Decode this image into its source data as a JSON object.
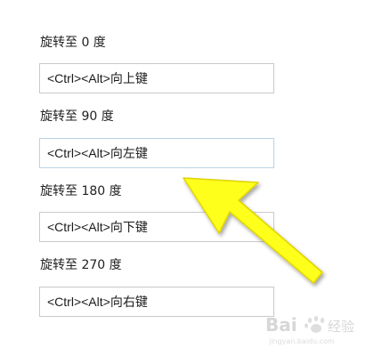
{
  "rotation_settings": [
    {
      "label": "旋转至 0 度",
      "shortcut": "<Ctrl><Alt>向上键"
    },
    {
      "label": "旋转至 90 度",
      "shortcut": "<Ctrl><Alt>向左键"
    },
    {
      "label": "旋转至 180 度",
      "shortcut": "<Ctrl><Alt>向下键"
    },
    {
      "label": "旋转至 270 度",
      "shortcut": "<Ctrl><Alt>向右键"
    }
  ],
  "colors": {
    "annotation_arrow": "#ffff1a",
    "arrow_outline": "#e0d300",
    "field_border": "#c9c9c9"
  },
  "annotation": {
    "icon": "arrow-pointer-icon"
  },
  "watermark": {
    "text": "Bai 经验",
    "sub": "jingyan.baidu.com"
  }
}
